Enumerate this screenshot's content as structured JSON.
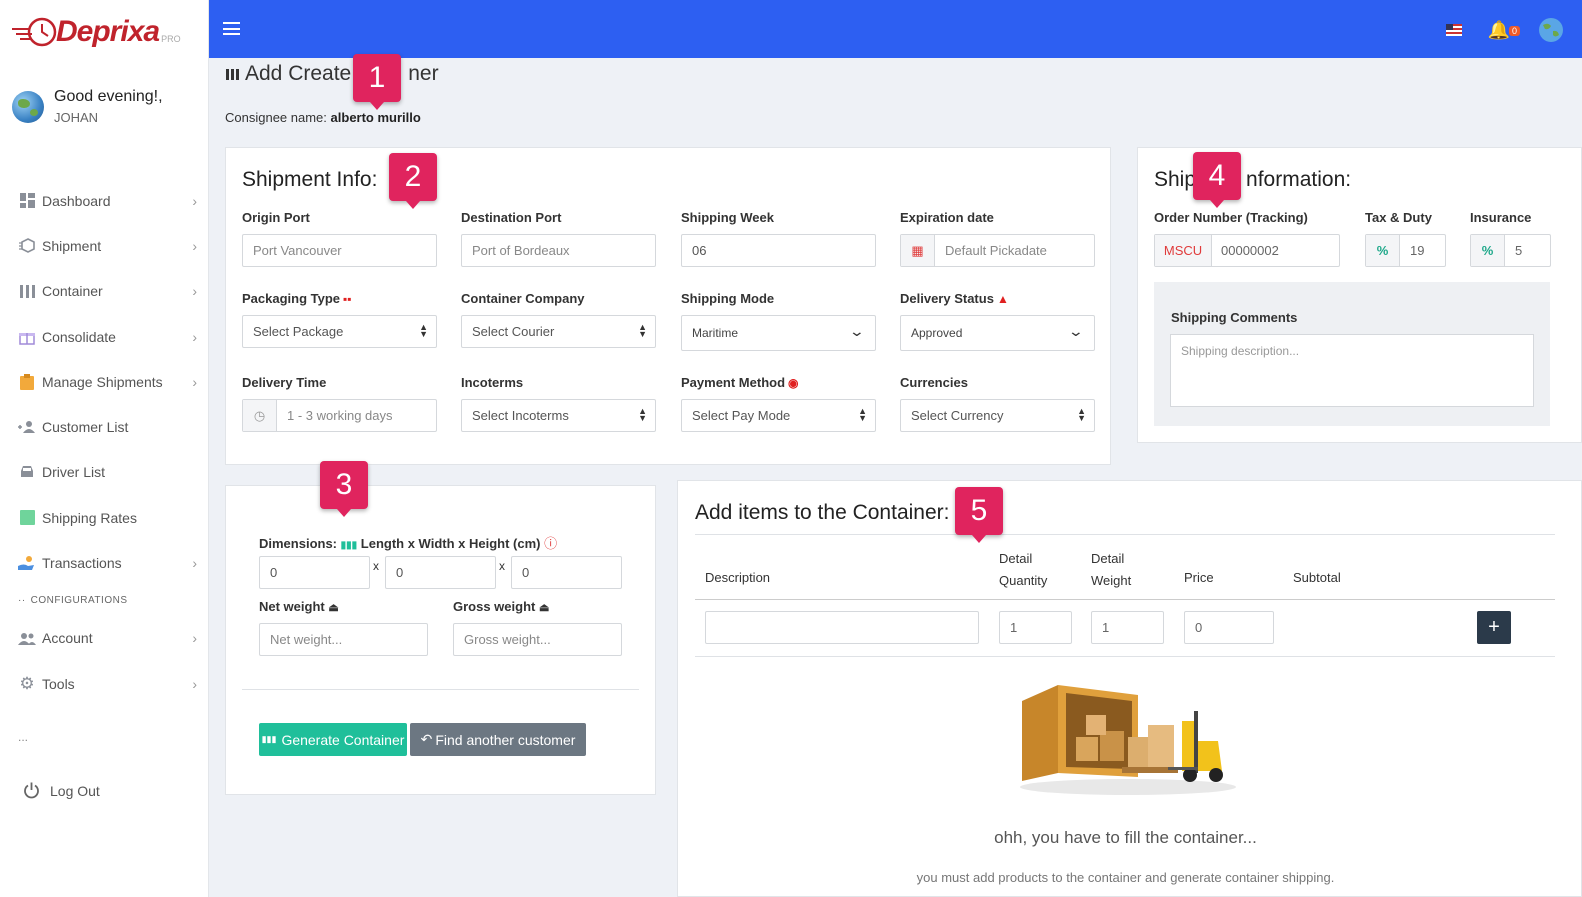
{
  "brand": {
    "name_prefix": "Depri",
    "name_x": "x",
    "name_suffix": "a",
    "pro": "PRO"
  },
  "sidebar": {
    "greeting": "Good evening!,",
    "username": "JOHAN",
    "items": [
      {
        "label": "Dashboard",
        "icon": "dashboard-icon",
        "chevron": true
      },
      {
        "label": "Shipment",
        "icon": "box-icon",
        "chevron": true
      },
      {
        "label": "Container",
        "icon": "container-icon",
        "chevron": true
      },
      {
        "label": "Consolidate",
        "icon": "gift-icon",
        "chevron": true
      },
      {
        "label": "Manage Shipments",
        "icon": "clipboard-icon",
        "chevron": true
      },
      {
        "label": "Customer List",
        "icon": "users-icon",
        "chevron": false
      },
      {
        "label": "Driver List",
        "icon": "car-icon",
        "chevron": false
      },
      {
        "label": "Shipping Rates",
        "icon": "rates-icon",
        "chevron": false
      },
      {
        "label": "Transactions",
        "icon": "hand-money-icon",
        "chevron": true
      }
    ],
    "section_label": "CONFIGURATIONS",
    "config_items": [
      {
        "label": "Account",
        "icon": "account-icon",
        "chevron": true
      },
      {
        "label": "Tools",
        "icon": "gear-icon",
        "chevron": true
      }
    ],
    "dots": "...",
    "logout": "Log Out"
  },
  "topbar": {
    "notifications": "0",
    "accent": "#2d5ff2"
  },
  "page": {
    "title_start": "Add Create C",
    "title_end": "ner",
    "consignee_label": "Consignee name:",
    "consignee_value": "alberto murillo"
  },
  "shipment_info": {
    "title": "Shipment Info:",
    "origin_port": {
      "label": "Origin Port",
      "placeholder": "Port Vancouver"
    },
    "destination_port": {
      "label": "Destination Port",
      "placeholder": "Port of Bordeaux"
    },
    "shipping_week": {
      "label": "Shipping Week",
      "value": "06"
    },
    "expiration_date": {
      "label": "Expiration date",
      "placeholder": "Default Pickadate"
    },
    "packaging_type": {
      "label": "Packaging Type",
      "value": "Select Package"
    },
    "container_company": {
      "label": "Container Company",
      "value": "Select Courier"
    },
    "shipping_mode": {
      "label": "Shipping Mode",
      "value": "Maritime"
    },
    "delivery_status": {
      "label": "Delivery Status",
      "value": "Approved"
    },
    "delivery_time": {
      "label": "Delivery Time",
      "value": "1 - 3 working days"
    },
    "incoterms": {
      "label": "Incoterms",
      "value": "Select Incoterms"
    },
    "payment_method": {
      "label": "Payment Method",
      "value": "Select Pay Mode"
    },
    "currencies": {
      "label": "Currencies",
      "value": "Select Currency"
    }
  },
  "shipping_information": {
    "title_start": "Ship",
    "title_end": "nformation:",
    "order_number": {
      "label": "Order Number (Tracking)",
      "prefix": "MSCU",
      "value": "00000002"
    },
    "tax_duty": {
      "label": "Tax & Duty",
      "symbol": "%",
      "value": "19"
    },
    "insurance": {
      "label": "Insurance",
      "symbol": "%",
      "value": "5"
    },
    "comments": {
      "label": "Shipping Comments",
      "placeholder": "Shipping description..."
    }
  },
  "dimensions": {
    "label": "Dimensions:",
    "label_rest": "Length x Width x Height (cm)",
    "length": "0",
    "width": "0",
    "height": "0",
    "times": "x",
    "net_weight": {
      "label": "Net weight",
      "placeholder": "Net weight..."
    },
    "gross_weight": {
      "label": "Gross weight",
      "placeholder": "Gross weight..."
    },
    "generate_button": "Generate Container",
    "find_button": "Find another customer"
  },
  "items": {
    "title": "Add items to the Container:",
    "columns": {
      "description": "Description",
      "detail_qty_1": "Detail",
      "detail_qty_2": "Quantity",
      "detail_weight_1": "Detail",
      "detail_weight_2": "Weight",
      "price": "Price",
      "subtotal": "Subtotal"
    },
    "row": {
      "description": "",
      "quantity": "1",
      "weight": "1",
      "price": "0"
    },
    "add_button": "+",
    "empty_title": "ohh, you have to fill the container...",
    "empty_text": "you must add products to the container and generate container shipping."
  },
  "markers": [
    "1",
    "2",
    "3",
    "4",
    "5"
  ]
}
